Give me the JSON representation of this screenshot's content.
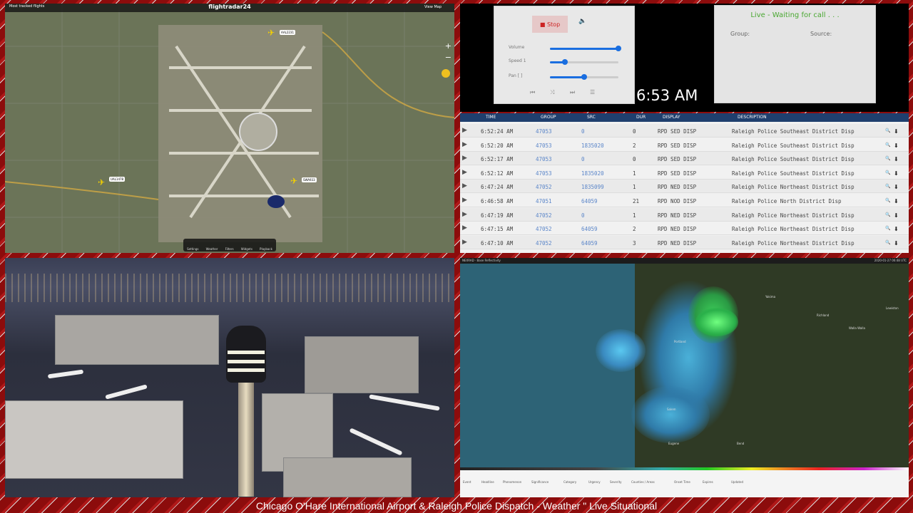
{
  "map": {
    "list_label": "Most tracked flights",
    "brand": "flightradar24",
    "view_label": "View  Map",
    "zoom_in": "+",
    "zoom_out": "−",
    "tools": [
      "Settings",
      "Weather",
      "Filters",
      "Widgets",
      "Playback"
    ],
    "tags": [
      "AAL2231",
      "UAL1478",
      "SWA933"
    ]
  },
  "player": {
    "stop_label": "Stop",
    "sliders": [
      {
        "name": "Volume",
        "value": 1.0
      },
      {
        "name": "Speed 1",
        "value": 0.22
      },
      {
        "name": "Pan [ ]",
        "value": 0.5
      }
    ],
    "clock": "6:53 AM",
    "live_title": "Live - Waiting for call . . .",
    "group_label": "Group:",
    "source_label": "Source:"
  },
  "calls": {
    "headers": [
      "TIME",
      "GROUP",
      "SRC",
      "DUR",
      "DISPLAY",
      "DESCRIPTION"
    ],
    "rows": [
      {
        "time": "6:52:24 AM",
        "group": "47053",
        "src": "0",
        "dur": "0",
        "display": "RPD SED DISP",
        "desc": "Raleigh Police Southeast District Disp"
      },
      {
        "time": "6:52:20 AM",
        "group": "47053",
        "src": "1835020",
        "dur": "2",
        "display": "RPD SED DISP",
        "desc": "Raleigh Police Southeast District Disp"
      },
      {
        "time": "6:52:17 AM",
        "group": "47053",
        "src": "0",
        "dur": "0",
        "display": "RPD SED DISP",
        "desc": "Raleigh Police Southeast District Disp"
      },
      {
        "time": "6:52:12 AM",
        "group": "47053",
        "src": "1835020",
        "dur": "1",
        "display": "RPD SED DISP",
        "desc": "Raleigh Police Southeast District Disp"
      },
      {
        "time": "6:47:24 AM",
        "group": "47052",
        "src": "1835099",
        "dur": "1",
        "display": "RPD NED DISP",
        "desc": "Raleigh Police Northeast District Disp"
      },
      {
        "time": "6:46:58 AM",
        "group": "47051",
        "src": "64059",
        "dur": "21",
        "display": "RPD NOD DISP",
        "desc": "Raleigh Police North District Disp"
      },
      {
        "time": "6:47:19 AM",
        "group": "47052",
        "src": "0",
        "dur": "1",
        "display": "RPD NED DISP",
        "desc": "Raleigh Police Northeast District Disp"
      },
      {
        "time": "6:47:15 AM",
        "group": "47052",
        "src": "64059",
        "dur": "2",
        "display": "RPD NED DISP",
        "desc": "Raleigh Police Northeast District Disp"
      },
      {
        "time": "6:47:10 AM",
        "group": "47052",
        "src": "64059",
        "dur": "3",
        "display": "RPD NED DISP",
        "desc": "Raleigh Police Northeast District Disp"
      }
    ]
  },
  "radar": {
    "top_left": "NEXRAD · Base Reflectivity",
    "top_right": "2020-01-27 06:48 UTC",
    "cities": [
      "Yakima",
      "Richland",
      "Walla Walla",
      "Portland",
      "Salem",
      "Eugene",
      "Bend",
      "Lewiston"
    ],
    "bottom_fields": [
      "Event",
      "Headline",
      "Phenomenon",
      "Significance",
      "Category",
      "Urgency",
      "Severity",
      "Counties / Areas",
      "Onset Time",
      "Expires",
      "Updated"
    ]
  },
  "caption": "Chicago O'Hare International Airport & Raleigh Police Dispatch - Weather \" Live Situational",
  "colors": {
    "accent": "#1a6ee0",
    "live": "#4aa832",
    "table_header": "#1f3f6e",
    "frame": "#8c0c0c"
  }
}
